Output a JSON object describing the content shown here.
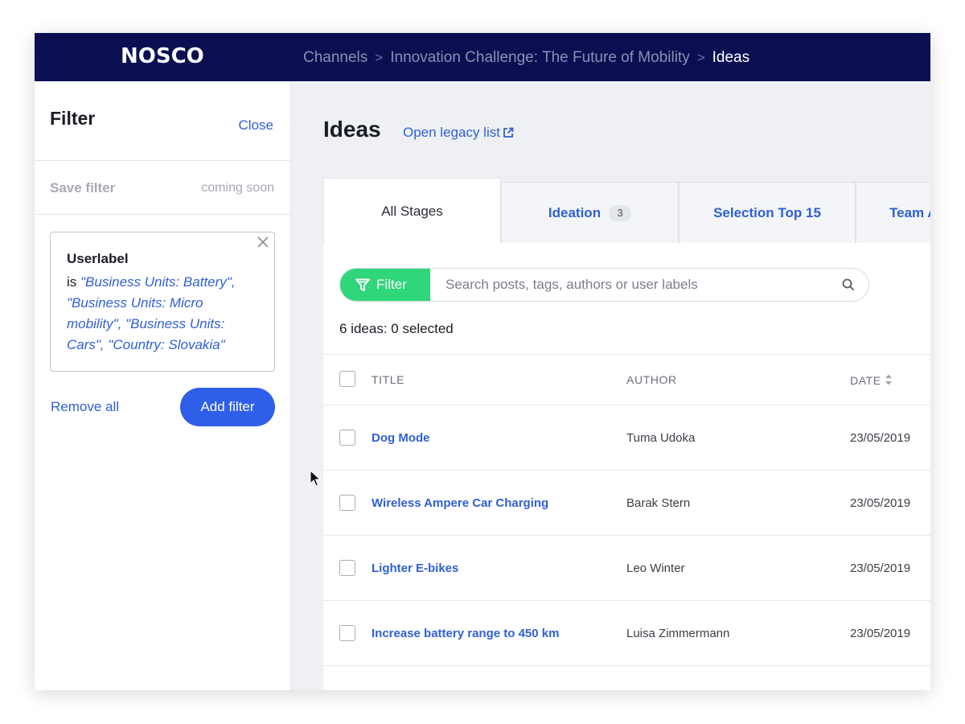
{
  "header": {
    "logo": "NOSCO",
    "breadcrumb": [
      "Channels",
      "Innovation Challenge: The Future of Mobility",
      "Ideas"
    ],
    "separator": ">",
    "bg_color": "#0b0f52"
  },
  "sidebar": {
    "title": "Filter",
    "close_label": "Close",
    "save_filter_label": "Save filter",
    "coming_soon_label": "coming soon",
    "filter_card": {
      "label": "Userlabel",
      "operator": "is",
      "values_text": "\"Business Units: Battery\", \"Business Units: Micro mobility\", \"Business Units: Cars\", \"Country: Slovakia\""
    },
    "remove_all_label": "Remove all",
    "add_filter_label": "Add filter"
  },
  "main": {
    "title": "Ideas",
    "legacy_link_label": "Open legacy list",
    "tabs": [
      {
        "label": "All Stages",
        "badge": ""
      },
      {
        "label": "Ideation",
        "badge": "3"
      },
      {
        "label": "Selection Top 15",
        "badge": ""
      },
      {
        "label": "Team A",
        "badge": ""
      }
    ],
    "filter_button_label": "Filter",
    "search_placeholder": "Search posts, tags, authors or user labels",
    "count_text": "6 ideas: 0 selected",
    "columns": {
      "title": "TITLE",
      "author": "AUTHOR",
      "date": "DATE"
    },
    "rows": [
      {
        "title": "Dog Mode",
        "author": "Tuma Udoka",
        "date": "23/05/2019"
      },
      {
        "title": "Wireless Ampere Car Charging",
        "author": "Barak Stern",
        "date": "23/05/2019"
      },
      {
        "title": "Lighter E-bikes",
        "author": "Leo Winter",
        "date": "23/05/2019"
      },
      {
        "title": "Increase battery range to 450 km",
        "author": "Luisa Zimmermann",
        "date": "23/05/2019"
      }
    ]
  },
  "colors": {
    "accent": "#2f5fd6",
    "primary_button": "#2f5fe8",
    "filter_green": "#2fd67a"
  },
  "icons": [
    "close-icon",
    "external-link-icon",
    "funnel-icon",
    "search-icon",
    "sort-icon",
    "mouse-cursor-icon"
  ]
}
